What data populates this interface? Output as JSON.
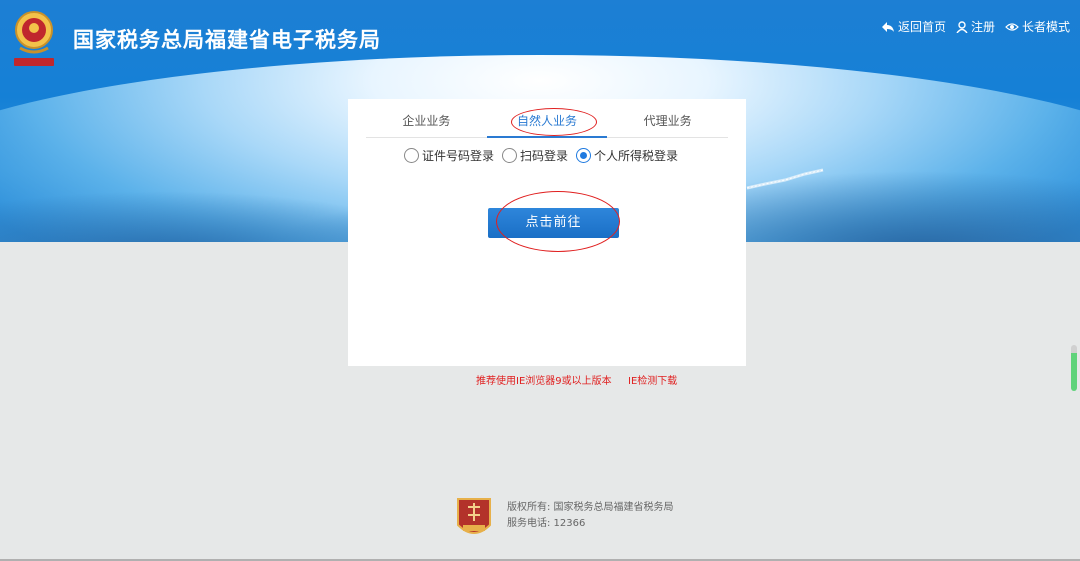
{
  "header": {
    "title": "国家税务总局福建省电子税务局",
    "links": [
      {
        "label": "返回首页",
        "icon": "back-icon"
      },
      {
        "label": "注册",
        "icon": "user-icon"
      },
      {
        "label": "长者模式",
        "icon": "eye-icon"
      }
    ]
  },
  "login": {
    "tabs": [
      {
        "label": "企业业务",
        "active": false
      },
      {
        "label": "自然人业务",
        "active": true
      },
      {
        "label": "代理业务",
        "active": false
      }
    ],
    "radios": [
      {
        "label": "证件号码登录",
        "checked": false
      },
      {
        "label": "扫码登录",
        "checked": false
      },
      {
        "label": "个人所得税登录",
        "checked": true
      }
    ],
    "button": "点击前往"
  },
  "tips": {
    "browser": "推荐使用IE浏览器9或以上版本",
    "download": "IE检测下载"
  },
  "footer": {
    "copyright": "版权所有: 国家税务总局福建省税务局",
    "phone": "服务电话: 12366"
  },
  "colors": {
    "brand_blue": "#1d7fd4",
    "accent": "#2a7ad2",
    "annotation_red": "#e02020"
  }
}
